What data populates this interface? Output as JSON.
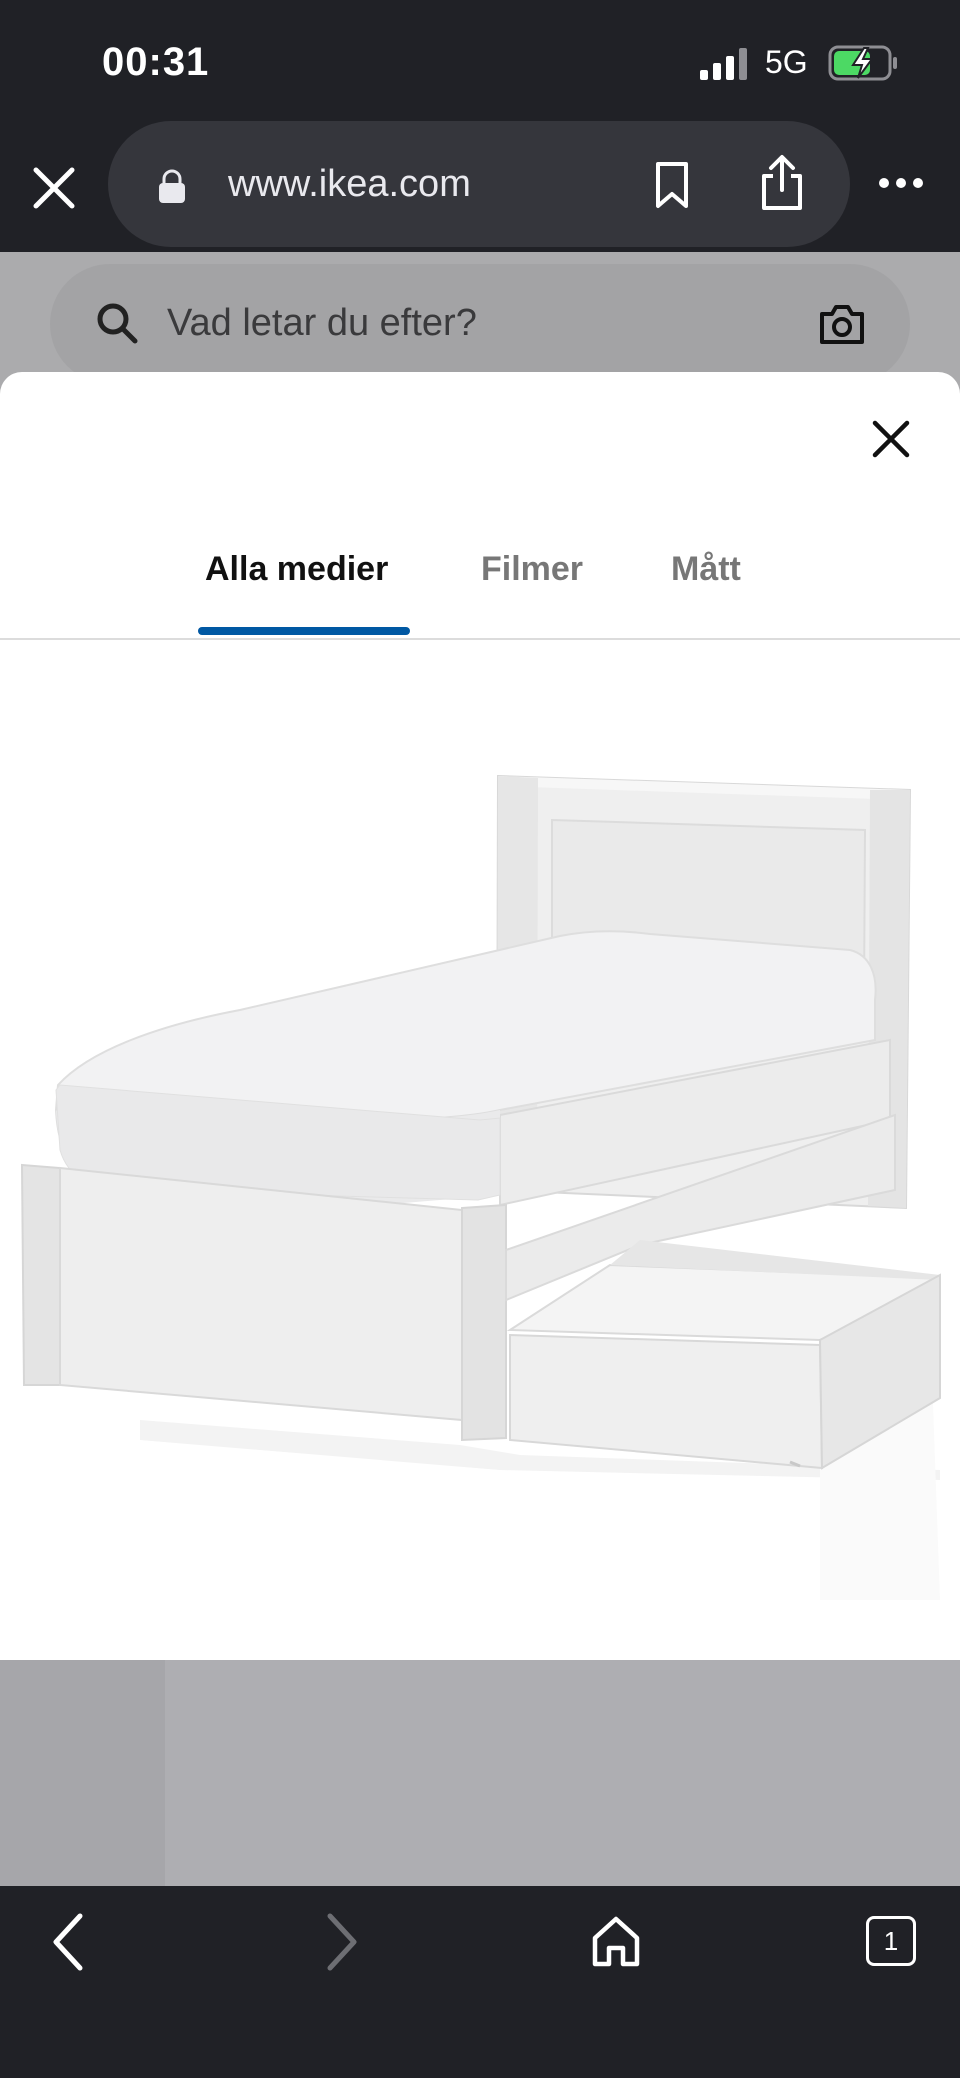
{
  "status_bar": {
    "time": "00:31",
    "network": "5G"
  },
  "browser": {
    "url": "www.ikea.com"
  },
  "search": {
    "placeholder": "Vad letar du efter?"
  },
  "media_sheet": {
    "tabs": [
      {
        "label": "Alla medier"
      },
      {
        "label": "Filmer"
      },
      {
        "label": "Mått"
      }
    ]
  },
  "toolbar": {
    "tabs_count": "1"
  },
  "colors": {
    "browser_chrome": "#202126",
    "tab_indicator": "#0058a3",
    "battery_charging": "#4cd964"
  },
  "icons": [
    "close-icon",
    "lock-icon",
    "bookmark-icon",
    "share-icon",
    "more-icon",
    "search-icon",
    "camera-icon",
    "back-icon",
    "forward-icon",
    "home-icon",
    "tabs-icon"
  ]
}
